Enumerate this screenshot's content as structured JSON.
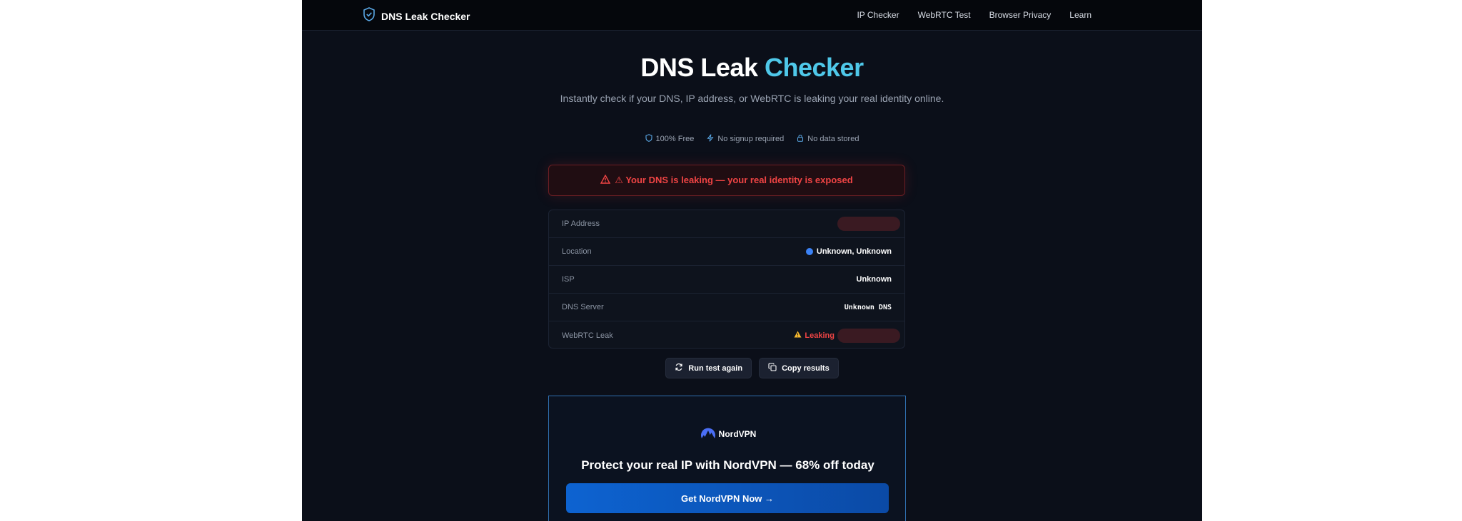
{
  "nav": {
    "brand": "DNS Leak Checker",
    "links": [
      "IP Checker",
      "WebRTC Test",
      "Browser Privacy",
      "Learn"
    ]
  },
  "hero": {
    "title_main": "DNS Leak",
    "title_accent": "Checker",
    "subtitle": "Instantly check if your DNS, IP address, or WebRTC is leaking your real identity online."
  },
  "badges": [
    {
      "icon": "shield-icon",
      "label": "100% Free"
    },
    {
      "icon": "bolt-icon",
      "label": "No signup required"
    },
    {
      "icon": "lock-icon",
      "label": "No data stored"
    }
  ],
  "alert": {
    "text": "⚠ Your DNS is leaking — your real identity is exposed"
  },
  "results": {
    "ip_label": "IP Address",
    "location_label": "Location",
    "location_value": "Unknown, Unknown",
    "isp_label": "ISP",
    "isp_value": "Unknown",
    "dns_label": "DNS Server",
    "dns_value": "Unknown DNS",
    "webrtc_label": "WebRTC Leak",
    "webrtc_value": "Leaking"
  },
  "actions": {
    "run_again": "Run test again",
    "copy": "Copy results"
  },
  "promo": {
    "brand": "NordVPN",
    "title": "Protect your real IP with NordVPN — 68% off today",
    "cta": "Get NordVPN Now →"
  },
  "colors": {
    "accent": "#4fc8e9",
    "danger": "#ef4444",
    "cta": "#0d63d1"
  }
}
